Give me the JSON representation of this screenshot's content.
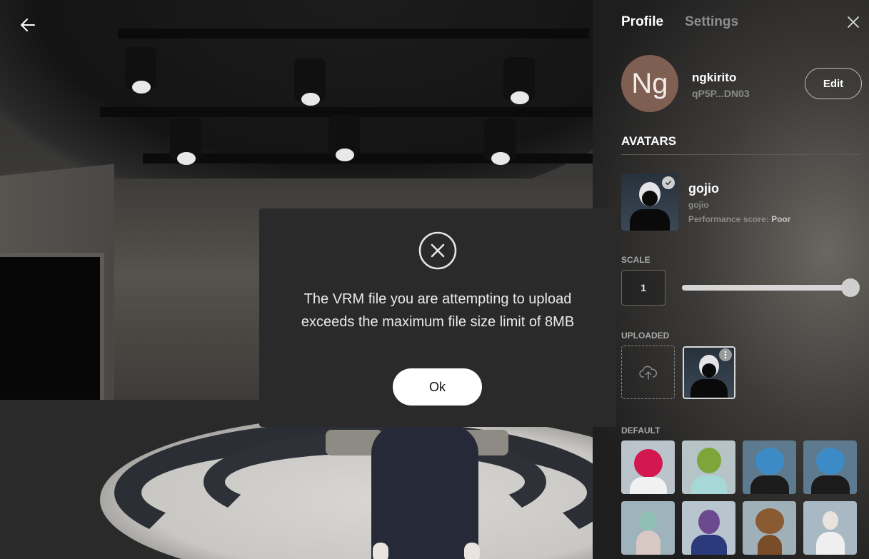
{
  "scene": {
    "back_icon": "arrow-left-icon"
  },
  "modal": {
    "icon": "x-circle-icon",
    "message_line1": "The VRM file you are attempting to upload",
    "message_line2": "exceeds the maximum file size limit of 8MB",
    "ok_label": "Ok"
  },
  "panel": {
    "tabs": [
      {
        "label": "Profile",
        "active": true
      },
      {
        "label": "Settings",
        "active": false
      }
    ],
    "close_icon": "close-icon",
    "profile": {
      "initials": "Ng",
      "username": "ngkirito",
      "wallet": "qP5P...DN03",
      "edit_label": "Edit"
    },
    "avatars_heading": "AVATARS",
    "current_avatar": {
      "name": "gojio",
      "subtitle": "gojio",
      "perf_label": "Performance score:",
      "perf_value": "Poor"
    },
    "scale": {
      "label": "SCALE",
      "value": "1",
      "slider_fraction": 1.0
    },
    "uploaded_label": "UPLOADED",
    "upload_icon": "cloud-upload-icon",
    "more_icon": "more-vertical-icon",
    "default_label": "DEFAULT",
    "colors": {
      "accent_white": "#ffffff",
      "panel_bg": "#3d3b39",
      "avatar_circle": "#7f5f52",
      "modal_bg": "#2a2a2a"
    }
  }
}
